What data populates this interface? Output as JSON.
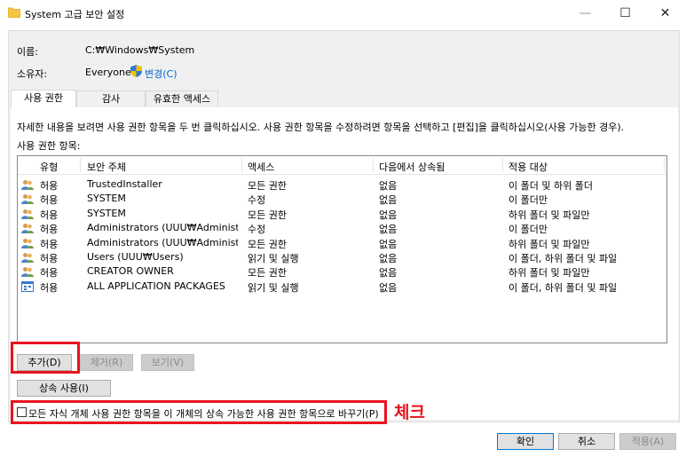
{
  "window": {
    "title": "System 고급 보안 설정",
    "min": "—",
    "max": "☐",
    "close": "✕"
  },
  "info": {
    "name_label": "이름:",
    "name_value": "C:₩Windows₩System",
    "owner_label": "소유자:",
    "owner_value": "Everyone",
    "change_link": "변경(C)"
  },
  "tabs": [
    {
      "label": "사용 권한",
      "active": true
    },
    {
      "label": "감사",
      "active": false
    },
    {
      "label": "유효한 액세스",
      "active": false
    }
  ],
  "description": "자세한 내용을 보려면 사용 권한 항목을 두 번 클릭하십시오. 사용 권한 항목을 수정하려면 항목을 선택하고 [편집]을 클릭하십시오(사용 가능한 경우).",
  "list_label": "사용 권한 항목:",
  "columns": [
    "유형",
    "보안 주체",
    "액세스",
    "다음에서 상속됨",
    "적용 대상"
  ],
  "entries": [
    {
      "type": "허용",
      "principal": "TrustedInstaller",
      "access": "모든 권한",
      "inherited": "없음",
      "applies": "이 폴더 및 하위 폴더",
      "icon": "users-icon"
    },
    {
      "type": "허용",
      "principal": "SYSTEM",
      "access": "수정",
      "inherited": "없음",
      "applies": "이 폴더만",
      "icon": "users-icon"
    },
    {
      "type": "허용",
      "principal": "SYSTEM",
      "access": "모든 권한",
      "inherited": "없음",
      "applies": "하위 폴더 및 파일만",
      "icon": "users-icon"
    },
    {
      "type": "허용",
      "principal": "Administrators (UUU₩Administrato...",
      "access": "수정",
      "inherited": "없음",
      "applies": "이 폴더만",
      "icon": "users-icon"
    },
    {
      "type": "허용",
      "principal": "Administrators (UUU₩Administrato...",
      "access": "모든 권한",
      "inherited": "없음",
      "applies": "하위 폴더 및 파일만",
      "icon": "users-icon"
    },
    {
      "type": "허용",
      "principal": "Users (UUU₩Users)",
      "access": "읽기 및 실행",
      "inherited": "없음",
      "applies": "이 폴더, 하위 폴더 및 파일",
      "icon": "users-icon"
    },
    {
      "type": "허용",
      "principal": "CREATOR OWNER",
      "access": "모든 권한",
      "inherited": "없음",
      "applies": "하위 폴더 및 파일만",
      "icon": "users-icon"
    },
    {
      "type": "허용",
      "principal": "ALL APPLICATION PACKAGES",
      "access": "읽기 및 실행",
      "inherited": "없음",
      "applies": "이 폴더, 하위 폴더 및 파일",
      "icon": "app-packages-icon"
    }
  ],
  "buttons": {
    "add": "추가(D)",
    "remove": "제거(R)",
    "view": "보기(V)",
    "inherit": "상속 사용(I)",
    "ok": "확인",
    "cancel": "취소",
    "apply": "적용(A)"
  },
  "replace_checkbox": {
    "label": "모든 자식 개체 사용 권한 항목을 이 개체의 상속 가능한 사용 권한 항목으로 바꾸기(P)",
    "checked": false
  },
  "annotation": "체크",
  "colors": {
    "highlight": "#e8141e",
    "link": "#0066cc"
  }
}
